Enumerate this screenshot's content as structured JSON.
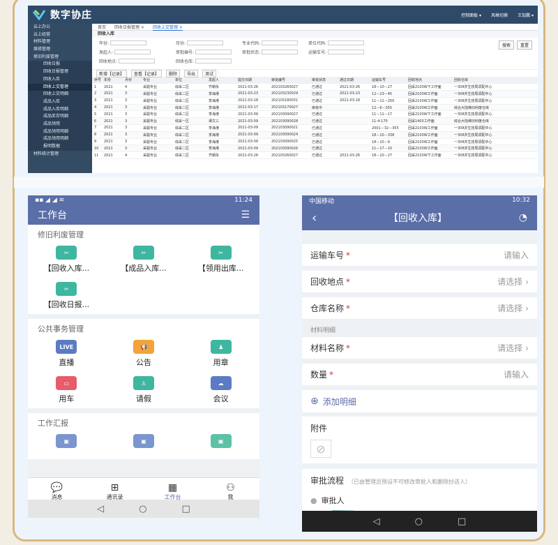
{
  "desktop": {
    "app_title": "数字协庄",
    "top_right": [
      "控制面板 ▾",
      "风格切换",
      "王加鹏 ▾"
    ],
    "tabs": [
      "首页",
      "回收日报管理 ×",
      "回收上交管理 ×"
    ],
    "breadcrumb": "回收入库",
    "sidebar": [
      "云上办公",
      "云上经营",
      "材料管理",
      "维修管理",
      "修旧利废管理",
      "回收日报",
      "回收日报管理",
      "回收入库",
      "回收上交管理",
      "回收上交明细",
      "成品入库",
      "成品入库明细",
      "成品库存明细",
      "成品领用",
      "成品领用明细",
      "成品领用明细",
      "报明数据",
      "材料统计管理"
    ],
    "form_fields": [
      "年份:",
      "月份:",
      "专业代码:",
      "单位代码:",
      "发起人:",
      "审批编号:",
      "审批状态:",
      "运输车号:",
      "回收地点:",
      "回收仓库:"
    ],
    "search_btn": "搜索",
    "reset_btn": "重置",
    "toolbar": [
      "新增【记录】",
      "查看【记录】",
      "删除",
      "导出",
      "测试"
    ],
    "table_headers": [
      "序号",
      "年份",
      "月份",
      "专业",
      "单位",
      "发起人",
      "提交日期",
      "审批编号",
      "审批状态",
      "通过日期",
      "运输车号",
      "回收地点",
      "回收仓库"
    ],
    "rows": [
      [
        "1",
        "2021",
        "4",
        "采掘专业",
        "综采二区",
        "齐朝永",
        "2021-03-26",
        "202103260027",
        "已通过",
        "2021-03-26",
        "18－10－27",
        "回采2103W下工作面",
        "一308井生技局调配中心"
      ],
      [
        "2",
        "2021",
        "3",
        "采掘专业",
        "综采二区",
        "李海港",
        "2021-03-23",
        "202103230029",
        "已通过",
        "2021-03-23",
        "12－23－45",
        "回采2103W工作面",
        "一308井生技局调配中心"
      ],
      [
        "3",
        "2021",
        "3",
        "采掘专业",
        "综采二区",
        "李海港",
        "2021-03-18",
        "202103180031",
        "已通过",
        "2021-03-18",
        "11－12－250",
        "回采2103W工作面",
        "一308井生技局调配中心"
      ],
      [
        "4",
        "2021",
        "3",
        "采掘专业",
        "综采二区",
        "李海港",
        "2021-03-17",
        "202103170027",
        "审批中",
        "",
        "12－6－355",
        "回采2103W工作面",
        "综合大陆维旧利废仓库"
      ],
      [
        "5",
        "2021",
        "3",
        "采掘专业",
        "综采二区",
        "李海港",
        "2021-03-09",
        "202103090027",
        "已通过",
        "",
        "11－11－17",
        "回采2103W下工作面",
        "一308井生技局调配中心"
      ],
      [
        "6",
        "2021",
        "3",
        "采掘专业",
        "综采一区",
        "谭文三",
        "2021-03-09",
        "202103090028",
        "已通过",
        "",
        "11-4-170",
        "回采1403工作面",
        "综合大陆维旧利废仓库"
      ],
      [
        "7",
        "2021",
        "3",
        "采掘专业",
        "综采二区",
        "李海港",
        "2021-03-09",
        "202103090021",
        "已通过",
        "",
        "2001－32－355",
        "回采2103W工作面",
        "一308井生技局调配中心"
      ],
      [
        "8",
        "2021",
        "3",
        "采掘专业",
        "综采二区",
        "李海港",
        "2021-03-09",
        "202103090024",
        "已通过",
        "",
        "18－10－338",
        "回采2103W工作面",
        "一308井生技局调配中心"
      ],
      [
        "9",
        "2021",
        "3",
        "采掘专业",
        "综采二区",
        "李海港",
        "2021-03-09",
        "202103090025",
        "已通过",
        "",
        "18－10－9",
        "回采2103W工作面",
        "一308井生技局调配中心"
      ],
      [
        "10",
        "2021",
        "3",
        "采掘专业",
        "综采二区",
        "李海港",
        "2021-03-09",
        "202103090026",
        "已通过",
        "",
        "11－17－10",
        "回采2103W工作面",
        "一308井生技局调配中心"
      ],
      [
        "11",
        "2021",
        "4",
        "采掘专业",
        "综采二区",
        "齐朝永",
        "2021-03-26",
        "202103260027",
        "已通过",
        "2021-03-26",
        "18－10－27",
        "回采2103W下工作面",
        "一308井生技局调配中心"
      ]
    ]
  },
  "phone1": {
    "status_time": "11:24",
    "title": "工作台",
    "sections": [
      {
        "name": "修旧利废管理",
        "items": [
          {
            "label": "【回收入库...",
            "icon": "tool-icon",
            "color": "#3fb6a0"
          },
          {
            "label": "【成品入库...",
            "icon": "tool-icon",
            "color": "#3fb6a0"
          },
          {
            "label": "【领用出库...",
            "icon": "tool-icon",
            "color": "#3fb6a0"
          },
          {
            "label": "【回收日报...",
            "icon": "tool-icon",
            "color": "#3fb6a0"
          }
        ]
      },
      {
        "name": "公共事务管理",
        "items": [
          {
            "label": "直播",
            "icon": "LIVE",
            "color": "#5b7cc4"
          },
          {
            "label": "公告",
            "icon": "megaphone-icon",
            "color": "#f2a33a"
          },
          {
            "label": "用章",
            "icon": "stamp-icon",
            "color": "#3fb6a0"
          },
          {
            "label": "用车",
            "icon": "car-icon",
            "color": "#e85b6a"
          },
          {
            "label": "请假",
            "icon": "person-icon",
            "color": "#3fb6a0"
          },
          {
            "label": "会议",
            "icon": "cloud-icon",
            "color": "#5b7cc4"
          }
        ]
      },
      {
        "name": "工作汇报",
        "items": []
      }
    ],
    "tabbar": [
      "消息",
      "通讯录",
      "工作台",
      "我"
    ]
  },
  "phone2": {
    "status_left": "中国移动",
    "status_time": "10:32",
    "title": "【回收入库】",
    "fields": [
      {
        "label": "运输车号",
        "value": "请输入"
      },
      {
        "label": "回收地点",
        "value": "请选择"
      },
      {
        "label": "仓库名称",
        "value": "请选择"
      }
    ],
    "detail_group": "材料明细",
    "detail_fields": [
      {
        "label": "材料名称",
        "value": "请选择"
      },
      {
        "label": "数量",
        "value": "请输入"
      }
    ],
    "add_detail": "添加明细",
    "attachment": "附件",
    "approval_title": "审批流程",
    "approval_note": "（已由管理员预设不可修改审批人和删除抄送人）",
    "approver": "审批人"
  }
}
